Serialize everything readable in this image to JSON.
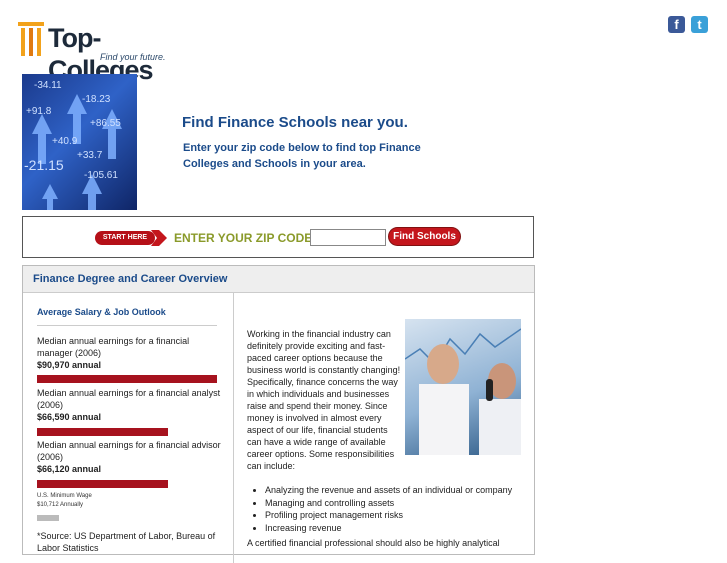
{
  "logo": {
    "name": "Top-Colleges",
    "tagline": "Find your future."
  },
  "social": {
    "facebook": "f",
    "twitter": "t"
  },
  "hero": {
    "title": "Find Finance Schools near you.",
    "subtitle": "Enter your zip code below to find top Finance Colleges and Schools in your area.",
    "image_numbers": [
      "-34.11",
      "-18.23",
      "+86.55",
      "+91.8",
      "-21.15",
      "+33.7",
      "-105.61",
      "+40.9"
    ]
  },
  "zip": {
    "start_label": "START HERE",
    "label": "ENTER YOUR ZIP CODE:",
    "value": "",
    "button": "Find Schools"
  },
  "panel": {
    "title": "Finance Degree and Career Overview",
    "salary_heading": "Average Salary & Job Outlook",
    "stats": [
      {
        "label": "Median annual earnings for a financial manager (2006)",
        "value": "$90,970 annual",
        "fraction": 1.0
      },
      {
        "label": "Median annual earnings for a financial analyst (2006)",
        "value": "$66,590 annual",
        "fraction": 0.73
      },
      {
        "label": "Median annual earnings for a financial advisor (2006)",
        "value": "$66,120 annual",
        "fraction": 0.73
      }
    ],
    "min_wage": {
      "label": "U.S. Minimum Wage",
      "value": "$10,712 Annually"
    },
    "source": "*Source: US Department of Labor, Bureau of Labor Statistics",
    "intro": "Working in the financial industry can definitely provide exciting and fast-paced career options because the business world is constantly changing! Specifically, finance concerns the way in which individuals and businesses raise and spend their money. Since money is involved in almost every aspect of our life, financial students can have a wide range of available career options. Some responsibilities can include:",
    "bullets": [
      "Analyzing the revenue and assets of an individual or company",
      "Managing and controlling assets",
      "Profiling project management risks",
      "Increasing revenue"
    ],
    "more": "A certified financial professional should also be highly analytical"
  }
}
